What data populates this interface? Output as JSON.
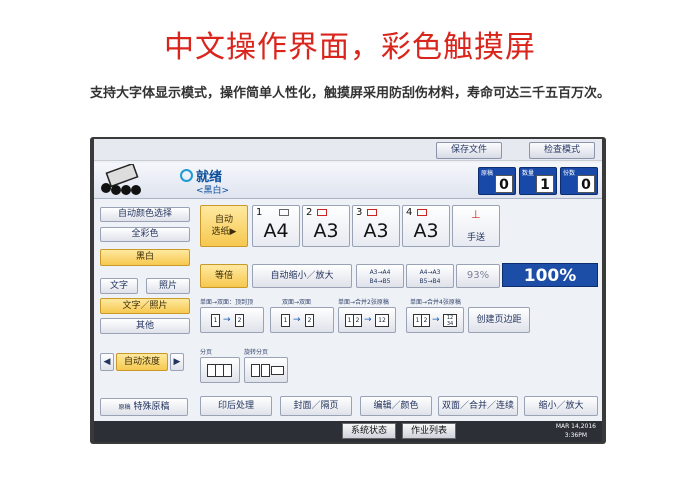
{
  "headline": "中文操作界面，彩色触摸屏",
  "subline": "支持大字体显示模式，操作简单人性化，触摸屏采用防刮伤材料，寿命可达三千五百万次。",
  "top_buttons": {
    "save_file": "保存文件",
    "check_mode": "检查模式"
  },
  "status": {
    "ready": "就绪",
    "mode": "<黑白>",
    "counters": [
      {
        "label": "原稿",
        "value": "0"
      },
      {
        "label": "数量",
        "value": "1"
      },
      {
        "label": "份数",
        "value": "0"
      }
    ]
  },
  "color_modes": [
    "自动颜色选择",
    "全彩色",
    "黑白"
  ],
  "original_types": {
    "text": "文字",
    "photo": "照片",
    "text_photo": "文字／照片",
    "other": "其他"
  },
  "density": {
    "label": "自动浓度",
    "left": "◀",
    "right": "▶"
  },
  "special_original": {
    "icon_label": "原稿",
    "label": "特殊原稿"
  },
  "paper": {
    "auto_select": "自动\n选纸▶",
    "trays": [
      {
        "num": "1",
        "size": "A4"
      },
      {
        "num": "2",
        "size": "A3"
      },
      {
        "num": "3",
        "size": "A3"
      },
      {
        "num": "4",
        "size": "A3"
      }
    ],
    "bypass": "手送"
  },
  "zoom": {
    "equal": "等倍",
    "auto_reduce_enlarge": "自动缩小／放大",
    "preset1": "A3→A4\nB4→B5",
    "preset2": "A4→A3\nB5→B4",
    "preset_pct": "93%",
    "current": "100%"
  },
  "duplex": {
    "label1": "单面→双面：顶到顶",
    "label2": "双面→双面",
    "label3": "单面→合并2张原稿",
    "label4": "单面→合并4张原稿",
    "create_margin": "创建页边距"
  },
  "sort": {
    "sort_label": "分页",
    "rotate_label": "旋转分页"
  },
  "bottom_tabs": [
    "印后处理",
    "封面／隔页",
    "编辑／颜色",
    "双面／合并／连续",
    "缩小／放大"
  ],
  "footer": {
    "system_status": "系统状态",
    "job_list": "作业列表",
    "date": "MAR 14,2016",
    "time": "3:36PM"
  }
}
